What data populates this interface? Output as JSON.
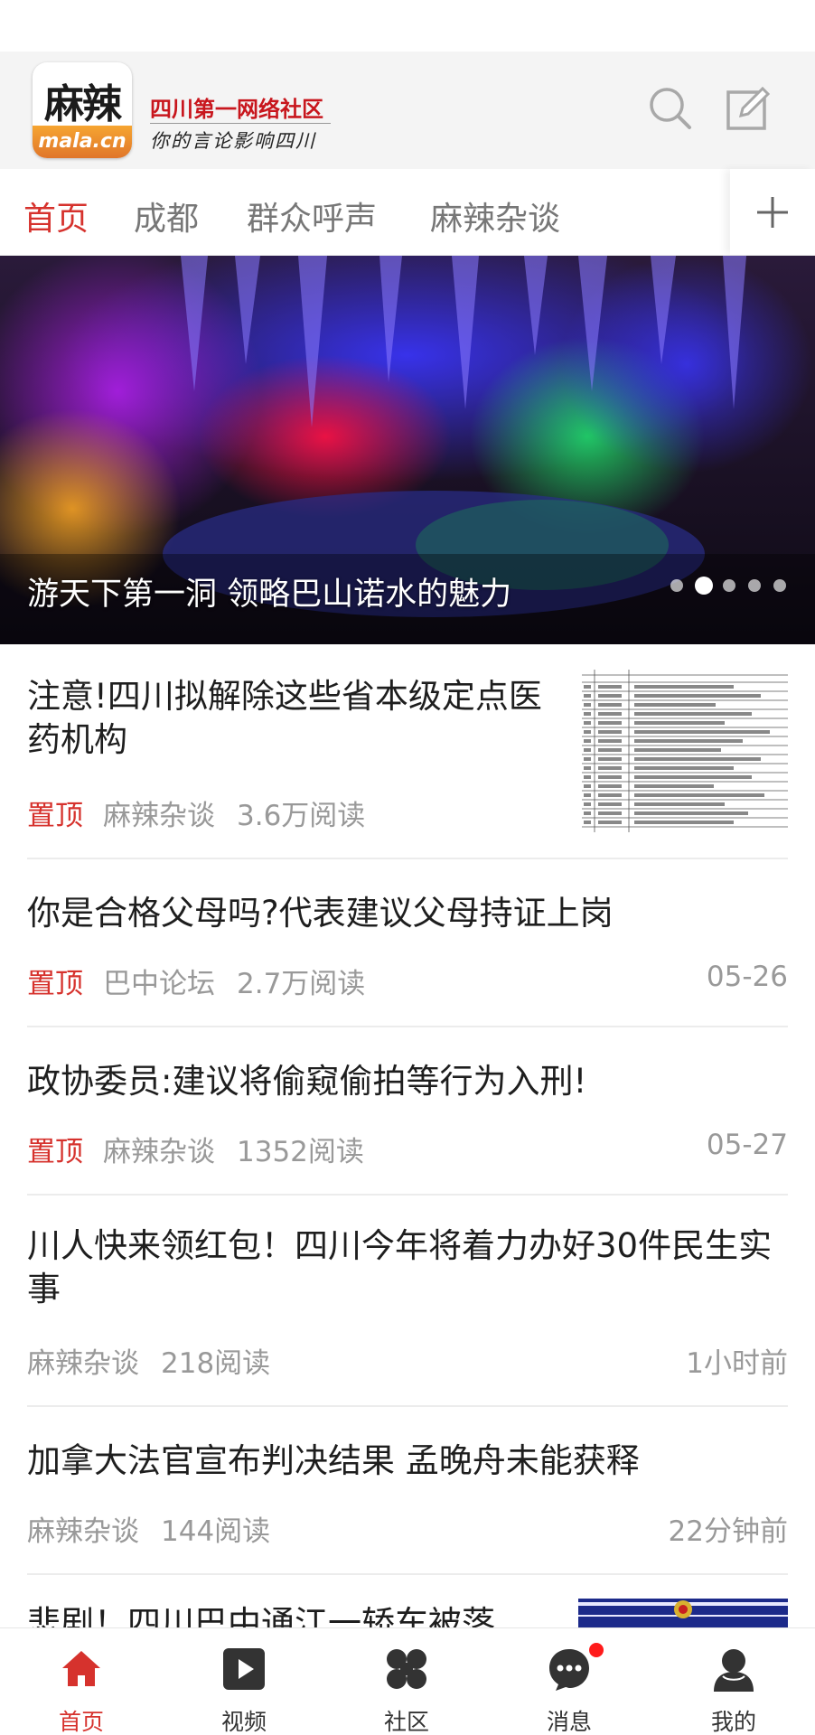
{
  "header": {
    "logo_text": "麻辣",
    "logo_domain": "mala.cn",
    "slogan": "四川第一网络社区",
    "tagline": "你的言论影响四川",
    "search_icon": "search-icon",
    "compose_icon": "compose-icon"
  },
  "channels": {
    "tabs": [
      "首页",
      "成都",
      "群众呼声",
      "麻辣杂谈"
    ],
    "active": "首页",
    "add_icon": "plus-icon"
  },
  "banner": {
    "caption": "游天下第一洞 领略巴山诺水的魅力",
    "slide_count": 5,
    "active_slide": 2
  },
  "news": [
    {
      "title": "注意!四川拟解除这些省本级定点医药机构",
      "pin": "置顶",
      "source": "麻辣杂谈",
      "reads": "3.6万阅读",
      "time": ""
    },
    {
      "title": "你是合格父母吗?代表建议父母持证上岗",
      "pin": "置顶",
      "source": "巴中论坛",
      "reads": "2.7万阅读",
      "time": "05-26"
    },
    {
      "title": "政协委员:建议将偷窥偷拍等行为入刑!",
      "pin": "置顶",
      "source": "麻辣杂谈",
      "reads": "1352阅读",
      "time": "05-27"
    },
    {
      "title": "川人快来领红包！四川今年将着力办好30件民生实事",
      "pin": "",
      "source": "麻辣杂谈",
      "reads": "218阅读",
      "time": "1小时前"
    },
    {
      "title": "加拿大法官宣布判决结果 孟晚舟未能获释",
      "pin": "",
      "source": "麻辣杂谈",
      "reads": "144阅读",
      "time": "22分钟前"
    },
    {
      "title": "悲剧！四川巴中通江一轿车被落",
      "pin": "",
      "source": "",
      "reads": "",
      "time": ""
    }
  ],
  "tabbar": {
    "items": [
      {
        "label": "首页",
        "icon": "home-icon"
      },
      {
        "label": "视频",
        "icon": "video-icon"
      },
      {
        "label": "社区",
        "icon": "community-icon"
      },
      {
        "label": "消息",
        "icon": "message-icon"
      },
      {
        "label": "我的",
        "icon": "profile-icon"
      }
    ],
    "active": "首页",
    "accent": "#d6322d"
  }
}
